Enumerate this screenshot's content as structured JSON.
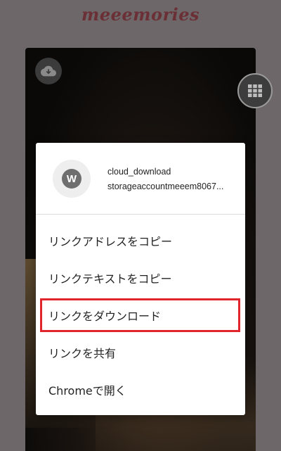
{
  "app": {
    "brand": "meeemories"
  },
  "background": {
    "download_icon": "cloud-download-icon",
    "grid_icon": "grid-view-icon"
  },
  "context_menu": {
    "favicon_letter": "W",
    "link_title": "cloud_download",
    "link_url": "storageaccountmeeem8067...",
    "items": [
      {
        "label": "リンクアドレスをコピー"
      },
      {
        "label": "リンクテキストをコピー"
      },
      {
        "label": "リンクをダウンロード",
        "highlighted": true
      },
      {
        "label": "リンクを共有"
      },
      {
        "label": "Chromeで開く"
      }
    ],
    "highlight_color": "#e0262c"
  }
}
